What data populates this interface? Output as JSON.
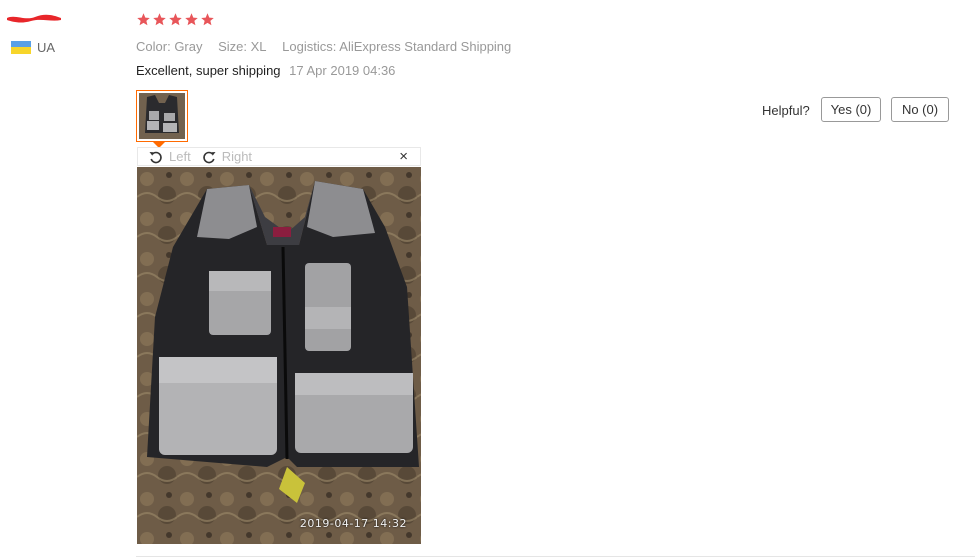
{
  "reviewer": {
    "country_code": "UA",
    "flag_colors": [
      "#5aa0e6",
      "#f7d52a"
    ]
  },
  "rating": {
    "stars": 5,
    "max": 5,
    "color": "#e8565a"
  },
  "attributes": {
    "color_label": "Color:",
    "color_value": "Gray",
    "size_label": "Size:",
    "size_value": "XL",
    "logistics_label": "Logistics:",
    "logistics_value": "AliExpress Standard Shipping"
  },
  "comment": {
    "text": "Excellent, super shipping",
    "date": "17 Apr 2019 04:36"
  },
  "helpful": {
    "label": "Helpful?",
    "yes_label": "Yes (0)",
    "no_label": "No (0)"
  },
  "viewer": {
    "rotate_left_label": "Left",
    "rotate_right_label": "Right",
    "close_symbol": "×",
    "photo_timestamp": "2019-04-17 14:32"
  },
  "colors": {
    "accent": "#ff6a00"
  }
}
